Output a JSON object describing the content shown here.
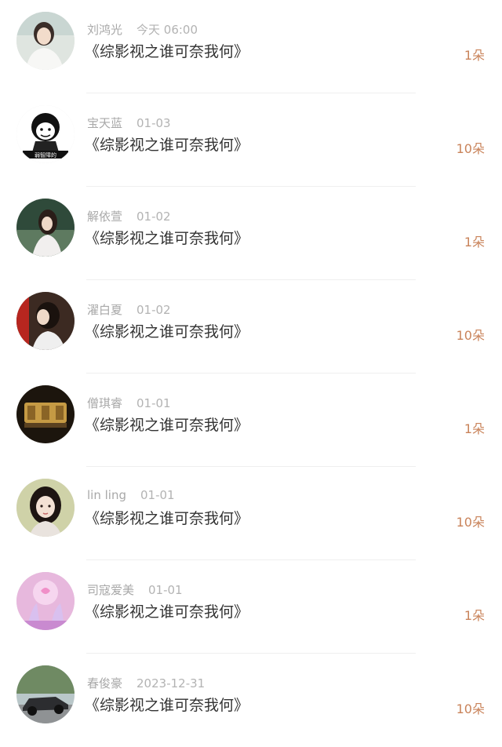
{
  "gifts": [
    {
      "user": "刘鸿光",
      "date": "今天 06:00",
      "book": "《综影视之谁可奈我何》",
      "amount": "1朵",
      "avatar": "girl-photo-icon"
    },
    {
      "user": "宝天蓝",
      "date": "01-03",
      "book": "《综影视之谁可奈我何》",
      "amount": "10朵",
      "avatar": "meme-face-icon",
      "avatar_caption": "弱智障的"
    },
    {
      "user": "解依萱",
      "date": "01-02",
      "book": "《综影视之谁可奈我何》",
      "amount": "1朵",
      "avatar": "girl-outdoor-icon"
    },
    {
      "user": "濯白夏",
      "date": "01-02",
      "book": "《综影视之谁可奈我何》",
      "amount": "10朵",
      "avatar": "girl-profile-icon"
    },
    {
      "user": "僧琪睿",
      "date": "01-01",
      "book": "《综影视之谁可奈我何》",
      "amount": "1朵",
      "avatar": "lit-room-icon"
    },
    {
      "user": "lin ling",
      "date": "01-01",
      "book": "《综影视之谁可奈我何》",
      "amount": "10朵",
      "avatar": "girl-portrait-icon"
    },
    {
      "user": "司寇爱美",
      "date": "01-01",
      "book": "《综影视之谁可奈我何》",
      "amount": "1朵",
      "avatar": "pink-dancers-icon"
    },
    {
      "user": "春俊豪",
      "date": "2023-12-31",
      "book": "《综影视之谁可奈我何》",
      "amount": "10朵",
      "avatar": "sports-car-icon"
    }
  ],
  "colors": {
    "amount": "#c9835a",
    "username": "#a8a8a8",
    "title": "#333333",
    "divider": "#efefef"
  }
}
